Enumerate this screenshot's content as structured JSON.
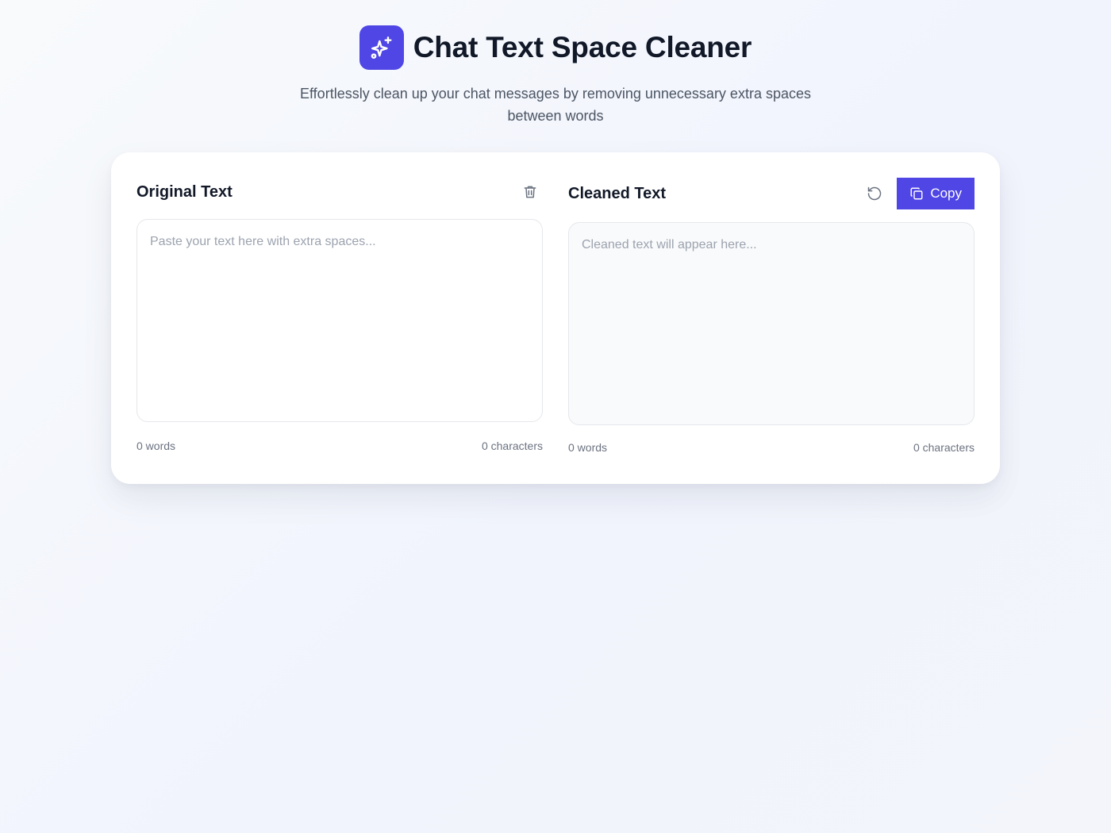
{
  "header": {
    "title": "Chat Text Space Cleaner",
    "subtitle": "Effortlessly clean up your chat messages by removing unnecessary extra spaces between words",
    "logo_icon": "sparkles-icon"
  },
  "original": {
    "title": "Original Text",
    "placeholder": "Paste your text here with extra spaces...",
    "value": "",
    "words": "0 words",
    "characters": "0 characters",
    "clear_icon": "trash-icon"
  },
  "cleaned": {
    "title": "Cleaned Text",
    "placeholder": "Cleaned text will appear here...",
    "value": "",
    "words": "0 words",
    "characters": "0 characters",
    "reset_icon": "rotate-ccw-icon",
    "copy_label": "Copy",
    "copy_icon": "copy-icon"
  },
  "colors": {
    "accent": "#4f46e5",
    "text": "#111827",
    "muted": "#6b7280",
    "placeholder": "#9ca3af",
    "border": "#e5e7eb"
  }
}
